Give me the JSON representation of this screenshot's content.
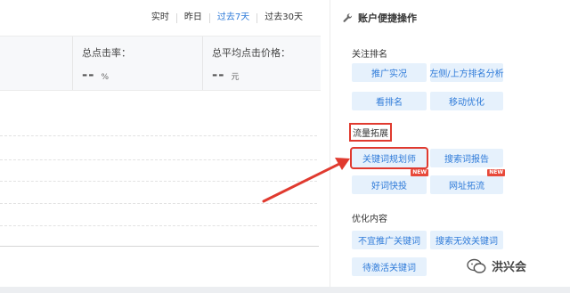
{
  "date_range": {
    "tabs": [
      {
        "label": "实时",
        "active": false
      },
      {
        "label": "昨日",
        "active": false
      },
      {
        "label": "过去7天",
        "active": true
      },
      {
        "label": "过去30天",
        "active": false
      }
    ]
  },
  "metrics": [
    {
      "title": "总点击率：",
      "value": "--",
      "unit": "%"
    },
    {
      "title": "总平均点击价格：",
      "value": "--",
      "unit": "元"
    }
  ],
  "account_panel": {
    "title": "账户便捷操作",
    "icon": "wrench-icon",
    "sections": {
      "follow_rank": {
        "label": "关注排名",
        "buttons": [
          "推广实况",
          "左侧/上方排名分析",
          "看排名",
          "移动优化"
        ]
      },
      "traffic_expand": {
        "label": "流量拓展",
        "buttons": [
          "关键词规划师",
          "搜索词报告",
          "好词快投",
          "网址拓流"
        ],
        "badge": "NEW"
      },
      "optimize_content": {
        "label": "优化内容",
        "buttons": [
          "不宜推广关键词",
          "搜索无效关键词",
          "待激活关键词"
        ]
      }
    }
  },
  "watermark": {
    "text": "洪兴会",
    "icon": "wechat-icon"
  },
  "colors": {
    "accent": "#2f7bd9",
    "button_bg": "#e6f1fc",
    "annotation_red": "#e03a2f",
    "badge_red": "#e8493a"
  }
}
